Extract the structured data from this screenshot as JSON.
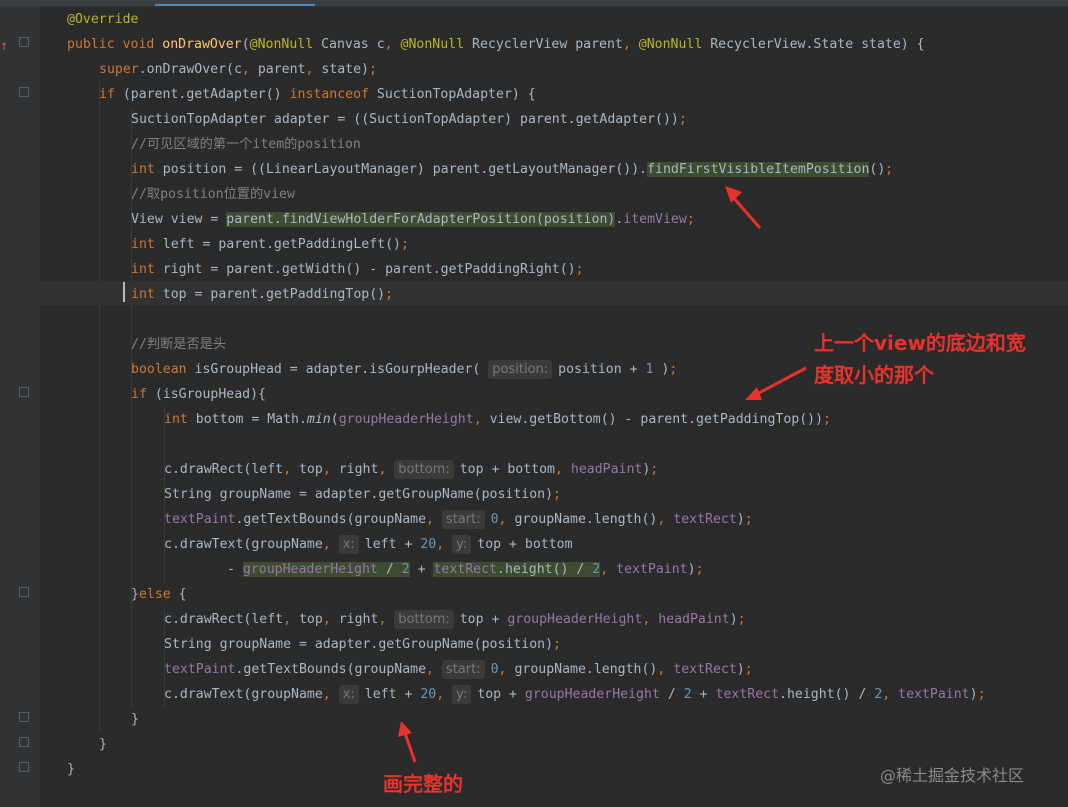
{
  "code_lines": [
    [
      {
        "t": "@Override",
        "c": "ann"
      }
    ],
    [
      {
        "t": "public void ",
        "c": "kw"
      },
      {
        "t": "onDrawOver",
        "c": "fn"
      },
      {
        "t": "("
      },
      {
        "t": "@NonNull",
        "c": "ann"
      },
      {
        "t": " Canvas c"
      },
      {
        "t": ", ",
        "c": "kw"
      },
      {
        "t": "@NonNull",
        "c": "ann"
      },
      {
        "t": " RecyclerView parent"
      },
      {
        "t": ", ",
        "c": "kw"
      },
      {
        "t": "@NonNull",
        "c": "ann"
      },
      {
        "t": " RecyclerView.State state) {"
      }
    ],
    [
      {
        "t": "super",
        "c": "kw"
      },
      {
        "t": ".onDrawOver(c"
      },
      {
        "t": ", ",
        "c": "kw"
      },
      {
        "t": "parent"
      },
      {
        "t": ", ",
        "c": "kw"
      },
      {
        "t": "state)"
      },
      {
        "t": ";",
        "c": "kw"
      }
    ],
    [
      {
        "t": "if ",
        "c": "kw"
      },
      {
        "t": "(parent.getAdapter() "
      },
      {
        "t": "instanceof ",
        "c": "kw"
      },
      {
        "t": "SuctionTopAdapter) {"
      }
    ],
    [
      {
        "t": "SuctionTopAdapter adapter = ((SuctionTopAdapter) parent.getAdapter())"
      },
      {
        "t": ";",
        "c": "kw"
      }
    ],
    [
      {
        "t": "//可见区域的第一个item的position",
        "c": "cm"
      }
    ],
    [
      {
        "t": "int ",
        "c": "kw"
      },
      {
        "t": "position = ((LinearLayoutManager) parent.getLayoutManager())."
      },
      {
        "t": "findFirstVisibleItemPosition",
        "c": "hl"
      },
      {
        "t": "()"
      },
      {
        "t": ";",
        "c": "kw"
      }
    ],
    [
      {
        "t": "//取position位置的view",
        "c": "cm"
      }
    ],
    [
      {
        "t": "View view = "
      },
      {
        "t": "parent.findViewHolderForAdapterPosition(position)",
        "c": "hl"
      },
      {
        "t": "."
      },
      {
        "t": "itemView",
        "c": "fld"
      },
      {
        "t": ";",
        "c": "kw"
      }
    ],
    [
      {
        "t": "int ",
        "c": "kw"
      },
      {
        "t": "left = parent.getPaddingLeft()"
      },
      {
        "t": ";",
        "c": "kw"
      }
    ],
    [
      {
        "t": "int ",
        "c": "kw"
      },
      {
        "t": "right = parent.getWidth() - parent.getPaddingRight()"
      },
      {
        "t": ";",
        "c": "kw"
      }
    ],
    [
      {
        "t": "int ",
        "c": "kw"
      },
      {
        "t": "top = parent.getPaddingTop()"
      },
      {
        "t": ";",
        "c": "kw"
      }
    ],
    [],
    [
      {
        "t": "//判断是否是头",
        "c": "cm"
      }
    ],
    [
      {
        "t": "boolean ",
        "c": "kw"
      },
      {
        "t": "isGroupHead = adapter.isGourpHeader( "
      },
      {
        "h": "position:"
      },
      {
        "t": "position + "
      },
      {
        "t": "1",
        "c": "num"
      },
      {
        "t": " )"
      },
      {
        "t": ";",
        "c": "kw"
      }
    ],
    [
      {
        "t": "if ",
        "c": "kw"
      },
      {
        "t": "(isGroupHead){"
      }
    ],
    [
      {
        "t": "int ",
        "c": "kw"
      },
      {
        "t": "bottom = Math."
      },
      {
        "t": "min",
        "c": "it"
      },
      {
        "t": "("
      },
      {
        "t": "groupHeaderHeight",
        "c": "fld"
      },
      {
        "t": ", ",
        "c": "kw"
      },
      {
        "t": "view.getBottom() - parent.getPaddingTop())"
      },
      {
        "t": ";",
        "c": "kw"
      }
    ],
    [],
    [
      {
        "t": "c.drawRect(left"
      },
      {
        "t": ", ",
        "c": "kw"
      },
      {
        "t": "top"
      },
      {
        "t": ", ",
        "c": "kw"
      },
      {
        "t": "right"
      },
      {
        "t": ", ",
        "c": "kw"
      },
      {
        "h": "bottom:"
      },
      {
        "t": "top + bottom"
      },
      {
        "t": ", ",
        "c": "kw"
      },
      {
        "t": "headPaint",
        "c": "fld"
      },
      {
        "t": ")"
      },
      {
        "t": ";",
        "c": "kw"
      }
    ],
    [
      {
        "t": "String groupName = adapter.getGroupName(position)"
      },
      {
        "t": ";",
        "c": "kw"
      }
    ],
    [
      {
        "t": "textPaint",
        "c": "fld"
      },
      {
        "t": ".getTextBounds(groupName"
      },
      {
        "t": ", ",
        "c": "kw"
      },
      {
        "h": "start:"
      },
      {
        "t": "0",
        "c": "num"
      },
      {
        "t": ", ",
        "c": "kw"
      },
      {
        "t": "groupName.length()"
      },
      {
        "t": ", ",
        "c": "kw"
      },
      {
        "t": "textRect",
        "c": "fld"
      },
      {
        "t": ")"
      },
      {
        "t": ";",
        "c": "kw"
      }
    ],
    [
      {
        "t": "c.drawText(groupName"
      },
      {
        "t": ", ",
        "c": "kw"
      },
      {
        "h": "x:"
      },
      {
        "t": "left + "
      },
      {
        "t": "20",
        "c": "num"
      },
      {
        "t": ", ",
        "c": "kw"
      },
      {
        "h": "y:"
      },
      {
        "t": "top + bottom"
      }
    ],
    [
      {
        "t": "- "
      },
      {
        "t": "groupHeaderHeight",
        "c": "fld hl"
      },
      {
        "t": " / ",
        "c": "hl"
      },
      {
        "t": "2",
        "c": "num hl"
      },
      {
        "t": " + "
      },
      {
        "t": "textRect",
        "c": "fld hl"
      },
      {
        "t": ".height() / ",
        "c": "hl"
      },
      {
        "t": "2",
        "c": "num hl"
      },
      {
        "t": ", ",
        "c": "kw"
      },
      {
        "t": "textPaint",
        "c": "fld"
      },
      {
        "t": ")"
      },
      {
        "t": ";",
        "c": "kw"
      }
    ],
    [
      {
        "t": "}"
      },
      {
        "t": "else ",
        "c": "kw"
      },
      {
        "t": "{"
      }
    ],
    [
      {
        "t": "c.drawRect(left"
      },
      {
        "t": ", ",
        "c": "kw"
      },
      {
        "t": "top"
      },
      {
        "t": ", ",
        "c": "kw"
      },
      {
        "t": "right"
      },
      {
        "t": ", ",
        "c": "kw"
      },
      {
        "h": "bottom:"
      },
      {
        "t": "top + "
      },
      {
        "t": "groupHeaderHeight",
        "c": "fld"
      },
      {
        "t": ", ",
        "c": "kw"
      },
      {
        "t": "headPaint",
        "c": "fld"
      },
      {
        "t": ")"
      },
      {
        "t": ";",
        "c": "kw"
      }
    ],
    [
      {
        "t": "String groupName = adapter.getGroupName(position)"
      },
      {
        "t": ";",
        "c": "kw"
      }
    ],
    [
      {
        "t": "textPaint",
        "c": "fld"
      },
      {
        "t": ".getTextBounds(groupName"
      },
      {
        "t": ", ",
        "c": "kw"
      },
      {
        "h": "start:"
      },
      {
        "t": "0",
        "c": "num"
      },
      {
        "t": ", ",
        "c": "kw"
      },
      {
        "t": "groupName.length()"
      },
      {
        "t": ", ",
        "c": "kw"
      },
      {
        "t": "textRect",
        "c": "fld"
      },
      {
        "t": ")"
      },
      {
        "t": ";",
        "c": "kw"
      }
    ],
    [
      {
        "t": "c.drawText(groupName"
      },
      {
        "t": ", ",
        "c": "kw"
      },
      {
        "h": "x:"
      },
      {
        "t": "left + "
      },
      {
        "t": "20",
        "c": "num"
      },
      {
        "t": ", ",
        "c": "kw"
      },
      {
        "h": "y:"
      },
      {
        "t": "top + "
      },
      {
        "t": "groupHeaderHeight",
        "c": "fld"
      },
      {
        "t": " / "
      },
      {
        "t": "2",
        "c": "num"
      },
      {
        "t": " + "
      },
      {
        "t": "textRect",
        "c": "fld"
      },
      {
        "t": ".height() / "
      },
      {
        "t": "2",
        "c": "num"
      },
      {
        "t": ", ",
        "c": "kw"
      },
      {
        "t": "textPaint",
        "c": "fld"
      },
      {
        "t": ")"
      },
      {
        "t": ";",
        "c": "kw"
      }
    ],
    [
      {
        "t": "}"
      }
    ],
    [
      {
        "t": "}"
      }
    ],
    [
      {
        "t": "}"
      }
    ]
  ],
  "annotations": {
    "note_min_line1": "上一个view的底边和宽",
    "note_min_line2": "度取小的那个",
    "note_complete": "画完整的"
  },
  "watermark": "@稀土掘金技术社区",
  "colors": {
    "background": "#2b2b2b",
    "keyword": "#cc7832",
    "annotation": "#bbb529",
    "method": "#ffc66d",
    "comment": "#808080",
    "number": "#6897bb",
    "field": "#9876aa",
    "note": "#e8322c"
  }
}
